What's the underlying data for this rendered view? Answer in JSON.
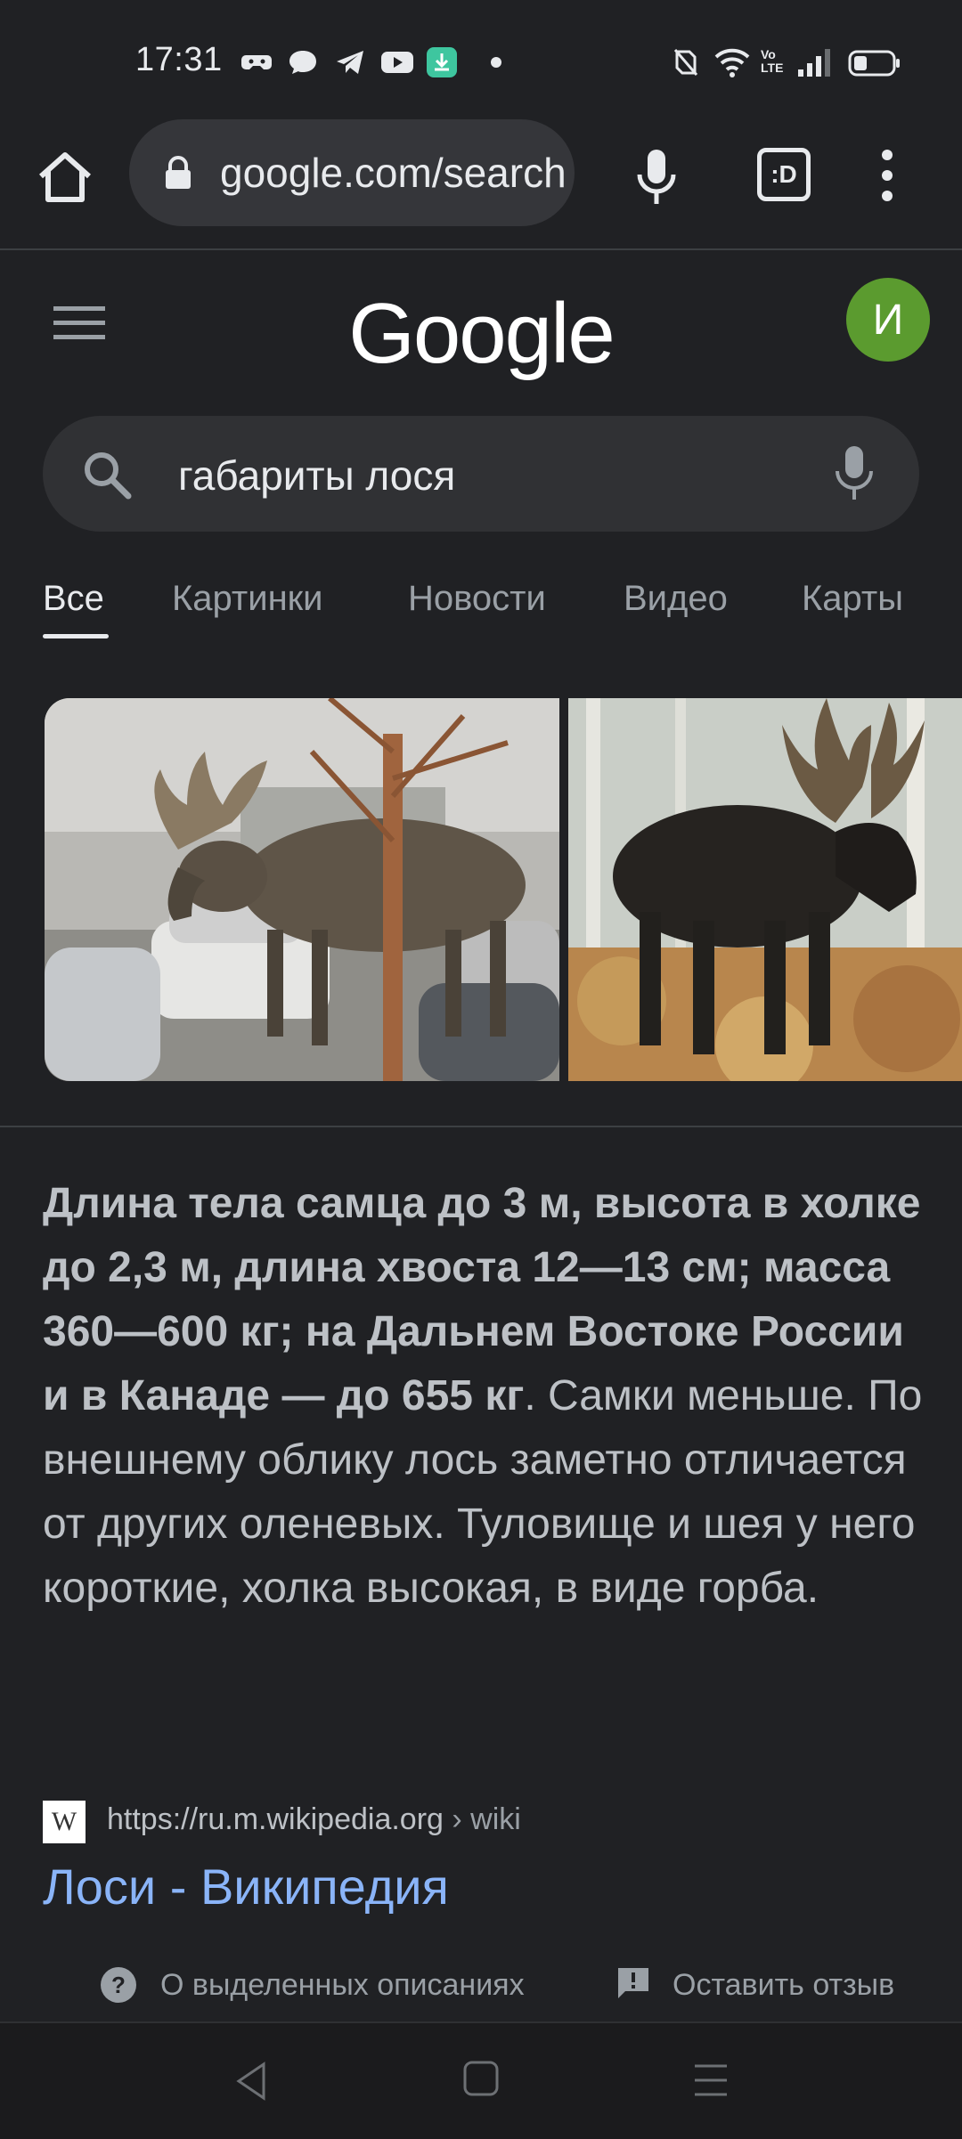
{
  "status_bar": {
    "time": "17:31",
    "notification_icons": [
      "game-icon",
      "chat-bubble-icon",
      "telegram-icon",
      "youtube-icon",
      "download-icon",
      "dot-icon"
    ],
    "system_icons": [
      "nfc-icon",
      "wifi-icon",
      "volte-icon",
      "signal-icon",
      "battery-icon"
    ],
    "volte_label": "Vo LTE"
  },
  "browser": {
    "url": "google.com/search",
    "tabs_label": ":D"
  },
  "google": {
    "logo": "Google",
    "avatar_letter": "И"
  },
  "search": {
    "query": "габариты лося"
  },
  "tabs": [
    {
      "label": "Все",
      "active": true
    },
    {
      "label": "Картинки",
      "active": false
    },
    {
      "label": "Новости",
      "active": false
    },
    {
      "label": "Видео",
      "active": false
    },
    {
      "label": "Карты",
      "active": false
    }
  ],
  "snippet": {
    "bold": "Длина тела самца до 3 м, высота в холке до 2,3 м, длина хвоста 12—13 см; масса 360—600 кг; на Дальнем Востоке России и в Канаде — до 655 кг",
    "rest": ". Самки меньше. По внешнему облику лось заметно отличается от других оленевых. Туловище и шея у него короткие, холка высокая, в виде горба."
  },
  "result": {
    "favicon": "W",
    "url": "https://ru.m.wikipedia.org",
    "breadcrumb": " › wiki",
    "title": "Лоси - Википедия"
  },
  "feedback": {
    "about": "О выделенных описаниях",
    "leave": "Оставить отзыв"
  },
  "colors": {
    "background": "#202124",
    "link": "#8ab4f8",
    "avatar": "#5b9b2f"
  }
}
